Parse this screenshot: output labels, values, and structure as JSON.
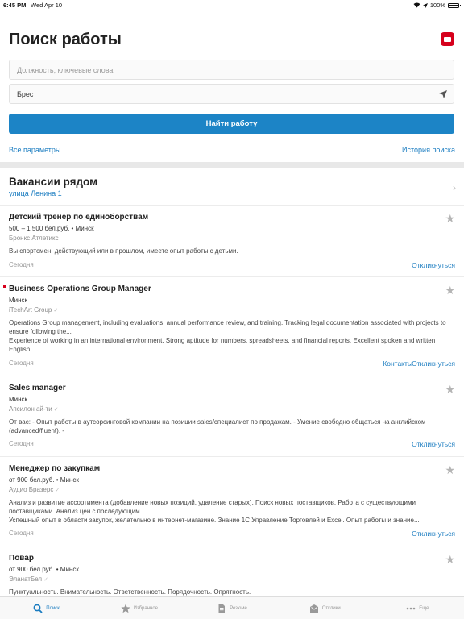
{
  "status": {
    "time": "6:45 PM",
    "date": "Wed Apr 10",
    "battery": "100%"
  },
  "header": {
    "title": "Поиск работы",
    "brand_icon": "brand-logo-icon"
  },
  "search": {
    "keywords_placeholder": "Должность, ключевые слова",
    "city_value": "Брест",
    "button_label": "Найти работу",
    "all_params": "Все параметры",
    "history": "История поиска"
  },
  "nearby": {
    "title": "Вакансии рядом",
    "subtitle": "улица Ленина 1"
  },
  "vacancies": [
    {
      "title": "Детский тренер по единоборствам",
      "salary_city": "500 – 1 500 бел.руб. • Минск",
      "company": "Бронкс Атлетикс",
      "verified": false,
      "description": "Вы спортсмен, действующий или в прошлом, имеете опыт работы с детьми.",
      "date": "Сегодня",
      "contacts": "",
      "respond": "Откликнуться"
    },
    {
      "title": "Business Operations Group Manager",
      "salary_city": "Минск",
      "company": "iTechArt Group",
      "verified": true,
      "description": "Operations Group management, including evaluations, annual performance review, and training. Tracking legal documentation associated with projects to ensure following the...",
      "description2": "Experience of working in an international environment. Strong aptitude for numbers, spreadsheets, and financial reports. Excellent spoken and written English...",
      "date": "Сегодня",
      "contacts": "Контакты",
      "respond": "Откликнуться"
    },
    {
      "title": "Sales manager",
      "salary_city": "Минск",
      "company": "Апсилон ай-ти",
      "verified": true,
      "description": "От вас: - Опыт работы в аутсорсинговой компании на позиции sales/специалист по продажам. - Умение свободно общаться на английском (advanced/fluent). -",
      "date": "Сегодня",
      "contacts": "",
      "respond": "Откликнуться"
    },
    {
      "title": "Менеджер по закупкам",
      "salary_city": "от 900 бел.руб. • Минск",
      "company": "Аудио Бразерс",
      "verified": true,
      "description": "Анализ и развитие ассортимента (добавление новых позиций, удаление старых). Поиск новых поставщиков. Работа с существующими поставщиками. Анализ цен с последующим...",
      "description2": "Успешный опыт в области закупок, желательно в интернет-магазине. Знание 1С Управление Торговлей и Excel. Опыт работы и знание...",
      "date": "Сегодня",
      "contacts": "",
      "respond": "Откликнуться"
    },
    {
      "title": "Повар",
      "salary_city": "от 900 бел.руб. • Минск",
      "company": "ЭланатБел",
      "verified": true,
      "description": "Пунктуальность. Внимательность. Ответственность. Порядочность. Опрятность."
    }
  ],
  "tabs": [
    {
      "label": "Поиск",
      "icon": "search-icon",
      "active": true
    },
    {
      "label": "Избранное",
      "icon": "star-icon",
      "active": false
    },
    {
      "label": "Резюме",
      "icon": "document-icon",
      "active": false
    },
    {
      "label": "Отклики",
      "icon": "inbox-icon",
      "active": false
    },
    {
      "label": "Еще",
      "icon": "more-icon",
      "active": false
    }
  ],
  "colors": {
    "accent": "#1c84c6",
    "brand": "#d6001c"
  }
}
